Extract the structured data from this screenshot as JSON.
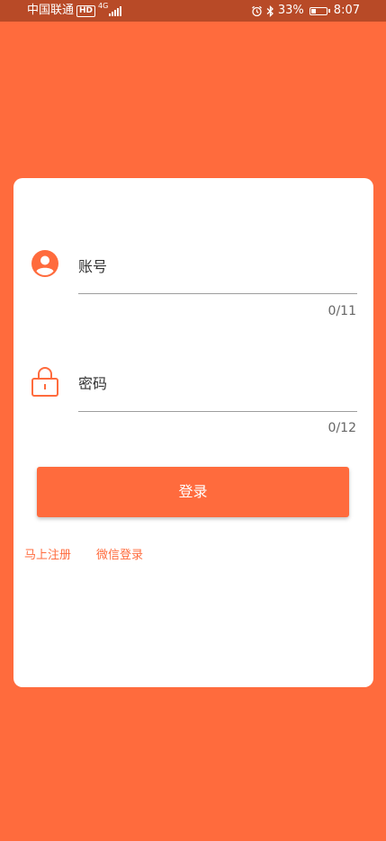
{
  "status_bar": {
    "carrier": "中国联通",
    "hd": "HD",
    "network": "4G",
    "battery_percent": "33%",
    "battery_level": 0.33,
    "time": "8:07",
    "icons": [
      "hd-badge",
      "signal-icon",
      "alarm-icon",
      "bluetooth-icon",
      "battery-icon"
    ]
  },
  "login": {
    "account": {
      "placeholder": "账号",
      "counter": "0/11",
      "icon": "user-icon"
    },
    "password": {
      "placeholder": "密码",
      "counter": "0/12",
      "icon": "lock-icon"
    },
    "submit_label": "登录",
    "register_link": "马上注册",
    "wechat_link": "微信登录"
  },
  "colors": {
    "accent": "#ff6b3d",
    "status_bar": "#b84a27",
    "card": "#ffffff"
  }
}
